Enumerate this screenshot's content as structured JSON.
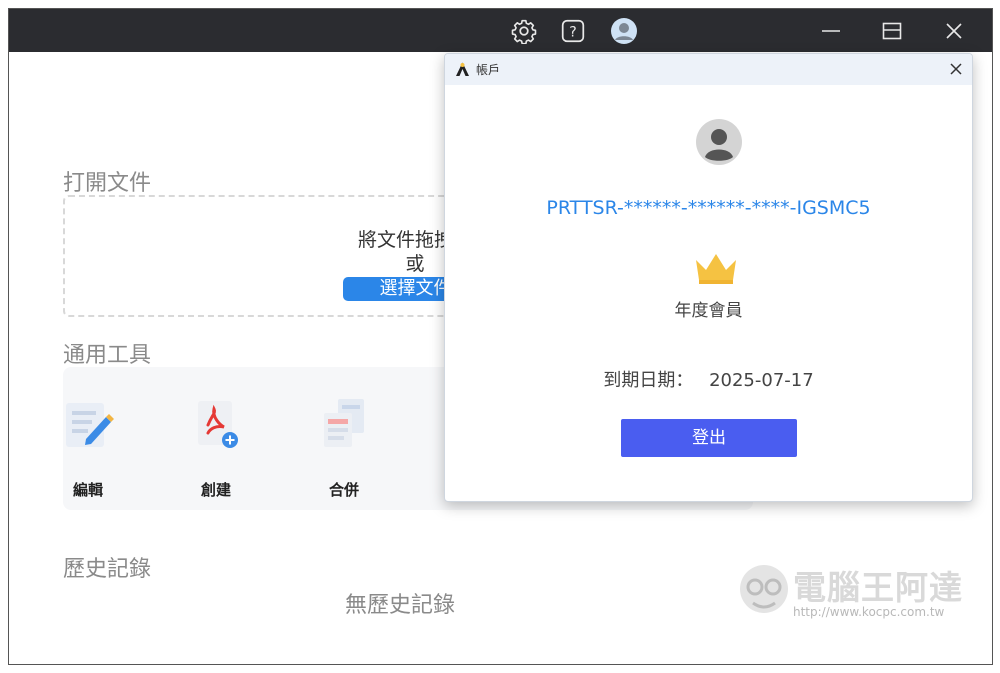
{
  "window": {
    "icons": [
      "gear-icon",
      "help-icon",
      "user-avatar-icon",
      "minimize-icon",
      "maximize-icon",
      "close-icon"
    ]
  },
  "main": {
    "open_file_heading": "打開文件",
    "dropzone_line1": "將文件拖拽到",
    "dropzone_or": "或",
    "select_file_label": "選擇文件",
    "tools_heading": "通用工具",
    "tools": [
      {
        "label": "編輯",
        "icon": "edit-document-icon"
      },
      {
        "label": "創建",
        "icon": "create-pdf-icon"
      },
      {
        "label": "合併",
        "icon": "merge-documents-icon"
      }
    ],
    "history_heading": "歷史記錄",
    "history_empty": "無歷史記錄"
  },
  "dialog": {
    "title": "帳戶",
    "account_id": "PRTTSR-******-******-****-IGSMC5",
    "plan": "年度會員",
    "expiry_label": "到期日期：",
    "expiry_value": "2025-07-17",
    "logout_label": "登出"
  },
  "watermark": {
    "title": "電腦王阿達",
    "url": "http://www.kocpc.com.tw"
  },
  "colors": {
    "titlebar": "#2b2c30",
    "accent_blue": "#2b86e8",
    "logout_button": "#4a5df0",
    "crown": "#f5c242"
  }
}
